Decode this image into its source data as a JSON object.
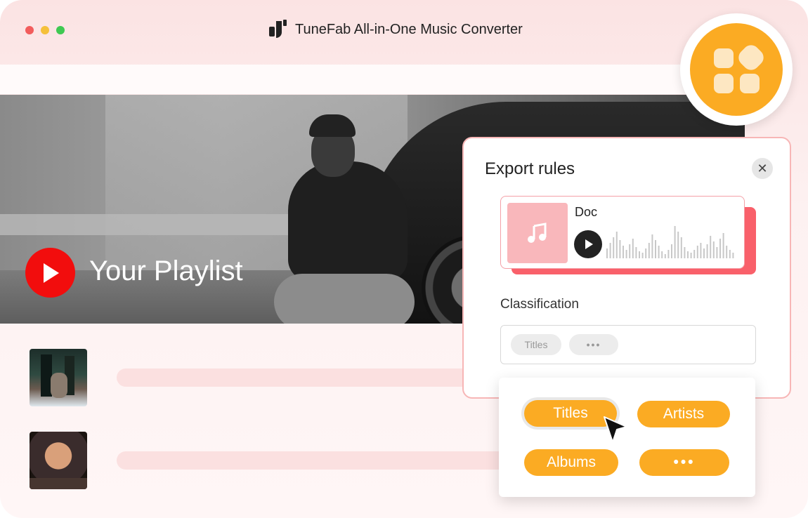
{
  "window": {
    "title": "TuneFab All-in-One Music Converter",
    "traffic_lights": [
      "close",
      "minimize",
      "maximize"
    ]
  },
  "hero": {
    "playlist_title": "Your Playlist"
  },
  "tracks": [
    {
      "art": "album-cover-1"
    },
    {
      "art": "album-cover-2"
    }
  ],
  "apps_badge": {
    "icon": "apps-grid-icon",
    "color": "#fbab23"
  },
  "dialog": {
    "title": "Export rules",
    "close_icon": "close-icon",
    "doc_card": {
      "name": "Doc",
      "icon": "music-note-icon"
    },
    "classification_label": "Classification",
    "selected_chips": [
      "Titles",
      "•••"
    ]
  },
  "dropdown": {
    "options": [
      "Titles",
      "Artists",
      "Albums",
      "•••"
    ]
  },
  "colors": {
    "accent_orange": "#fbab23",
    "accent_red": "#f9606a",
    "youtube_red": "#f20d0d"
  }
}
